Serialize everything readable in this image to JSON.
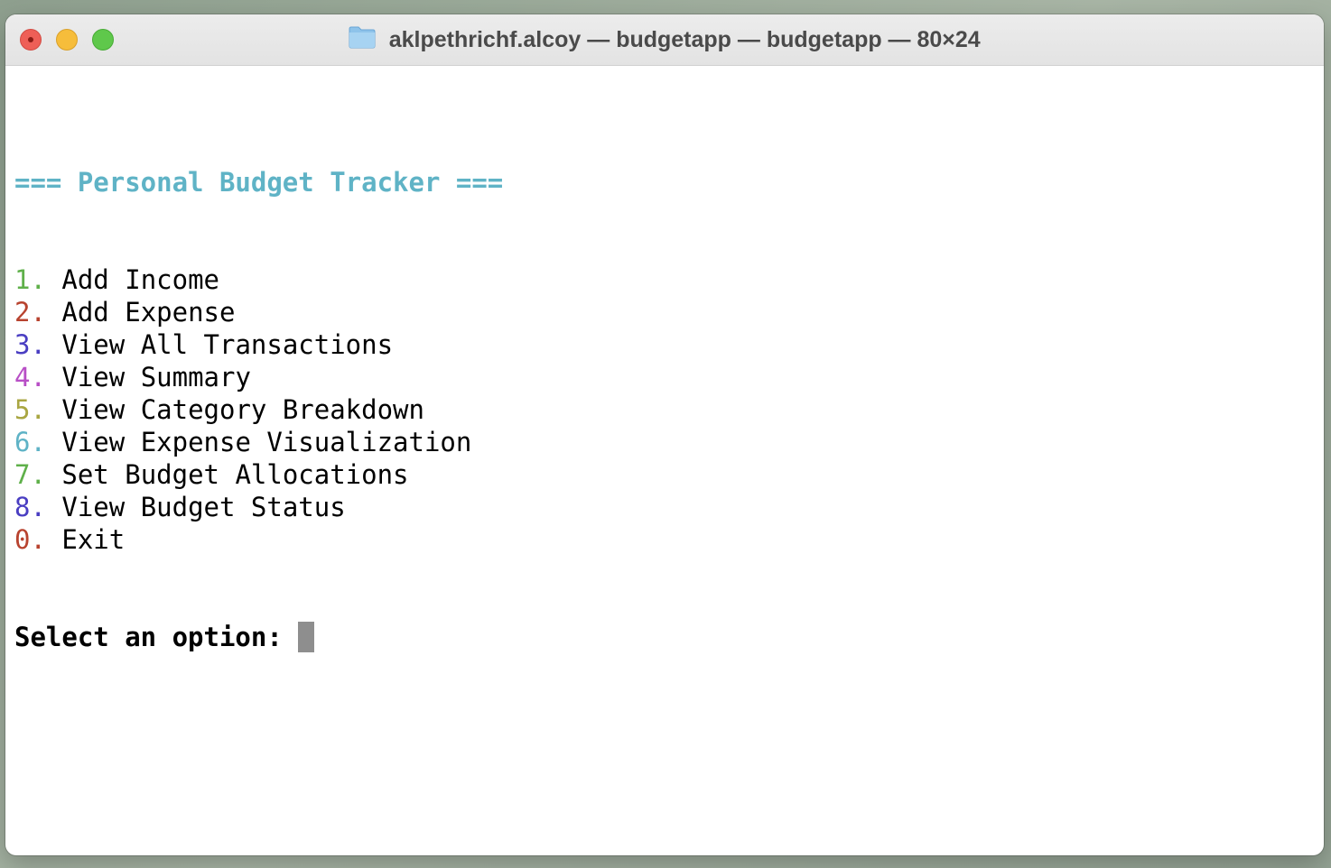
{
  "window": {
    "title": "aklpethrichf.alcoy — budgetapp — budgetapp — 80×24",
    "folder_icon": "folder-icon"
  },
  "terminal": {
    "header": "=== Personal Budget Tracker ===",
    "menu": [
      {
        "number": "1.",
        "label": "Add Income",
        "color": "#5fb04a"
      },
      {
        "number": "2.",
        "label": "Add Expense",
        "color": "#b8432f"
      },
      {
        "number": "3.",
        "label": "View All Transactions",
        "color": "#4a3ec2"
      },
      {
        "number": "4.",
        "label": "View Summary",
        "color": "#b84fc6"
      },
      {
        "number": "5.",
        "label": "View Category Breakdown",
        "color": "#a9a642"
      },
      {
        "number": "6.",
        "label": "View Expense Visualization",
        "color": "#5fb3c6"
      },
      {
        "number": "7.",
        "label": "Set Budget Allocations",
        "color": "#5fb04a"
      },
      {
        "number": "8.",
        "label": "View Budget Status",
        "color": "#4a3ec2"
      },
      {
        "number": "0.",
        "label": "Exit",
        "color": "#b8432f"
      }
    ],
    "prompt": "Select an option: "
  },
  "colors": {
    "header": "#5fb3c6",
    "cursor": "#8e8e8e"
  }
}
